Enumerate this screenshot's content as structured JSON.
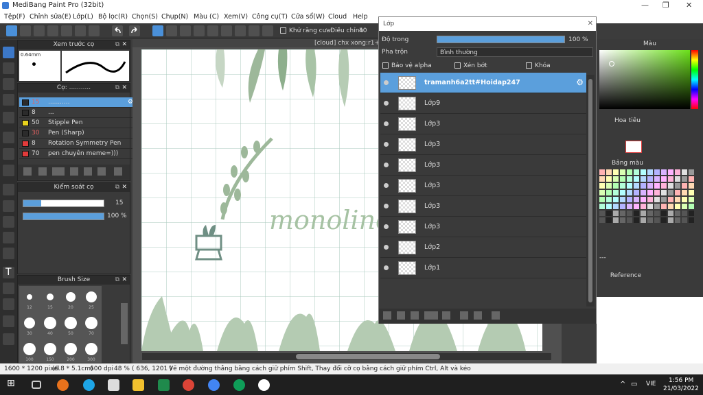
{
  "window": {
    "title": "MediBang Paint Pro (32bit)"
  },
  "menu": [
    "Tệp(F)",
    "Chỉnh sửa(E)",
    "Lớp(L)",
    "Bộ lọc(R)",
    "Chọn(S)",
    "Chụp(N)",
    "Màu (C)",
    "Xem(V)",
    "Công cụ(T)",
    "Cửa sổ(W)",
    "Cloud",
    "Help"
  ],
  "toolbar": {
    "antialias_label": "Khử răng cưa",
    "adjust_label": "Điều chỉnh",
    "adjust_value": "40"
  },
  "brush_preview": {
    "title": "Xem trước cọ",
    "size": "0.64mm"
  },
  "brush_list": {
    "title": "Cọ: ...........",
    "items": [
      {
        "num": "15",
        "name": "...........",
        "color": "#2b2b2b"
      },
      {
        "num": "8",
        "name": "...",
        "color": "#2b2b2b"
      },
      {
        "num": "50",
        "name": "Stipple Pen",
        "color": "#e8d21d"
      },
      {
        "num": "30",
        "name": "Pen (Sharp)",
        "color": "#2b2b2b"
      },
      {
        "num": "8",
        "name": "Rotation Symmetry Pen",
        "color": "#e23b3b"
      },
      {
        "num": "70",
        "name": "pen chuyên meme=)))",
        "color": "#e23b3b"
      }
    ]
  },
  "brush_control": {
    "title": "Kiểm soát cọ",
    "size_value": "15",
    "opacity_value": "100 %",
    "size_fill": 0.22,
    "opacity_fill": 1.0
  },
  "brush_size": {
    "title": "Brush Size",
    "sizes": [
      "12",
      "15",
      "20",
      "25",
      "30",
      "40",
      "50",
      "70",
      "100",
      "150",
      "200",
      "300"
    ]
  },
  "canvas": {
    "tab_title": "[cloud] chx xong:r1+",
    "lettering": "monoline"
  },
  "layer_window": {
    "title": "Lớp",
    "opacity_label": "Độ trong",
    "opacity_value": "100 %",
    "blend_label": "Pha trộn",
    "blend_value": "Bình thường",
    "protect_alpha": "Bảo vệ alpha",
    "clipping": "Xén bớt",
    "lock": "Khóa",
    "layers": [
      "tramanh6a2tt#Hoidap247",
      "Lớp9",
      "Lớp3",
      "Lớp3",
      "Lớp3",
      "Lớp3",
      "Lớp3",
      "Lớp3",
      "Lớp2",
      "Lớp1"
    ]
  },
  "right": {
    "color_title": "Màu",
    "navigator_title": "Hoa tiêu",
    "palette_title": "Bảng màu",
    "reference_title": "Reference",
    "palette_dash": "---"
  },
  "status": {
    "size": "1600 * 1200 pixel",
    "size_cm": "(6.8 * 5.1cm)",
    "dpi": "600 dpi",
    "zoom": "48 %",
    "coords": "( 636, 1201 )",
    "hint": "Vẽ một đường thẳng bằng cách giữ phím Shift, Thay đổi cỡ cọ bằng cách giữ phím Ctrl, Alt và kéo"
  },
  "taskbar": {
    "lang": "VIE",
    "time": "1:56 PM",
    "date": "21/03/2022"
  }
}
